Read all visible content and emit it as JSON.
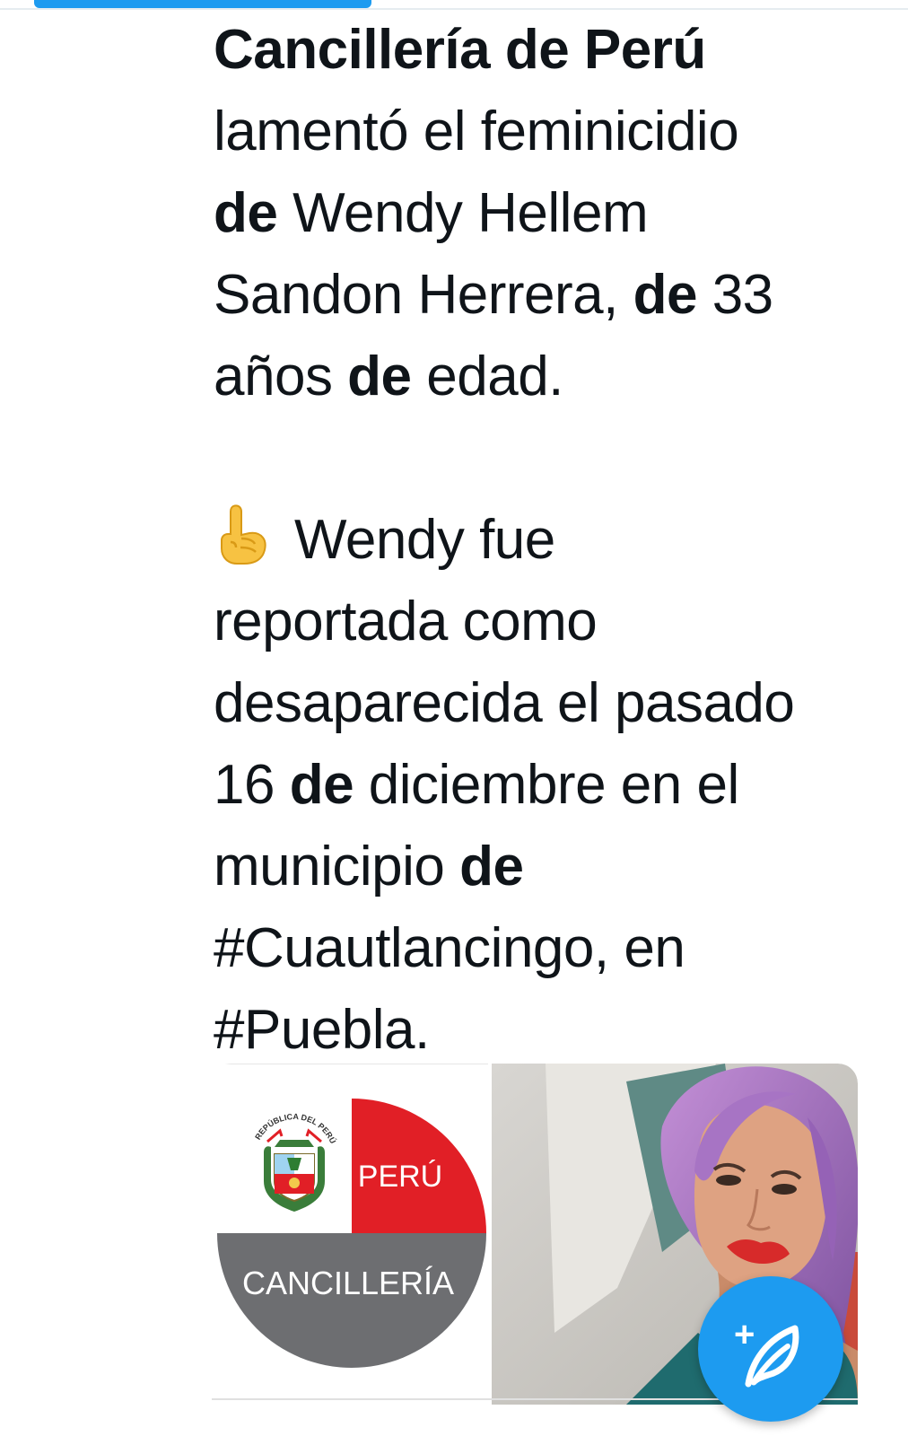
{
  "tweet": {
    "lines": [
      [
        {
          "t": "Cancillería de Perú",
          "b": true
        }
      ],
      [
        {
          "t": "lamentó el feminicidio",
          "b": false
        }
      ],
      [
        {
          "t": "de",
          "b": true
        },
        {
          "t": " Wendy Hellem",
          "b": false
        }
      ],
      [
        {
          "t": "Sandon Herrera, ",
          "b": false
        },
        {
          "t": "de",
          "b": true
        },
        {
          "t": " 33",
          "b": false
        }
      ],
      [
        {
          "t": "años ",
          "b": false
        },
        {
          "t": "de",
          "b": true
        },
        {
          "t": " edad.",
          "b": false
        }
      ]
    ],
    "emoji_icon": "index-pointing-up-icon",
    "lines2_first": "Wendy fue",
    "lines2": [
      [
        {
          "t": "reportada como",
          "b": false
        }
      ],
      [
        {
          "t": "desaparecida el pasado",
          "b": false
        }
      ],
      [
        {
          "t": "16 ",
          "b": false
        },
        {
          "t": "de",
          "b": true
        },
        {
          "t": " diciembre en el",
          "b": false
        }
      ],
      [
        {
          "t": "municipio ",
          "b": false
        },
        {
          "t": "de",
          "b": true
        }
      ],
      [
        {
          "t": "#Cuautlancingo, en",
          "b": false
        }
      ],
      [
        {
          "t": "#Puebla.",
          "b": false
        }
      ]
    ]
  },
  "media": {
    "logo_top": "PERÚ",
    "logo_bottom": "CANCILLERÍA",
    "seal_text": "REPÚBLICA DEL PERÚ"
  },
  "compose_button": {
    "icon": "compose-feather-icon",
    "plus": "+"
  },
  "colors": {
    "accent": "#1d9bf0",
    "peru_red": "#e11f26",
    "cancilleria_gray": "#6d6e71"
  }
}
